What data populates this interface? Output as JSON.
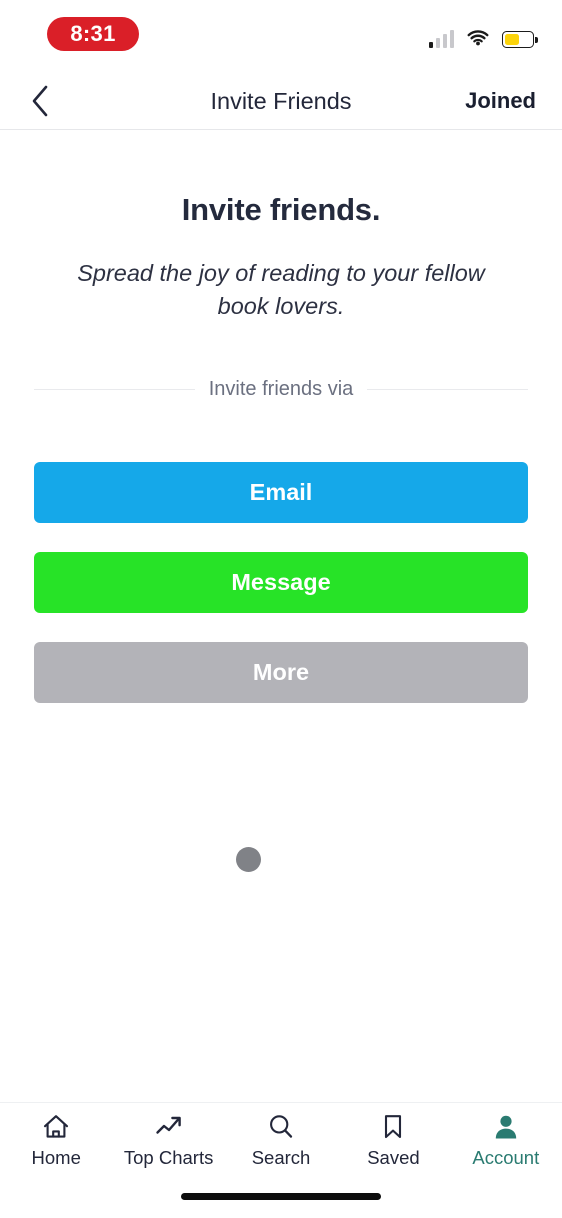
{
  "status_bar": {
    "time": "8:31",
    "recording_pill_color": "#da1f28",
    "signal_icon": "cellular-signal-icon",
    "signal_bars_filled": 1,
    "signal_bars_total": 4,
    "wifi_icon": "wifi-icon",
    "battery_icon": "battery-icon",
    "battery_level_percent": 52,
    "battery_fill_color": "#fcd40b"
  },
  "header": {
    "back_icon": "chevron-left-icon",
    "title": "Invite Friends",
    "action_label": "Joined"
  },
  "main": {
    "headline": "Invite friends.",
    "subheadline": "Spread the joy of reading to your fellow book lovers.",
    "divider_label": "Invite friends via",
    "buttons": [
      {
        "label": "Email",
        "name": "invite-via-email-button",
        "color": "#15a8e9"
      },
      {
        "label": "Message",
        "name": "invite-via-message-button",
        "color": "#27e327"
      },
      {
        "label": "More",
        "name": "invite-via-more-button",
        "color": "#b3b3b8"
      }
    ],
    "loading_indicator": {
      "name": "loading-dot-indicator",
      "color": "#808287"
    }
  },
  "tab_bar": {
    "active_color": "#2a7b71",
    "inactive_color": "#23273a",
    "items": [
      {
        "label": "Home",
        "icon": "home-icon",
        "active": false
      },
      {
        "label": "Top Charts",
        "icon": "trending-up-icon",
        "active": false
      },
      {
        "label": "Search",
        "icon": "search-icon",
        "active": false
      },
      {
        "label": "Saved",
        "icon": "bookmark-icon",
        "active": false
      },
      {
        "label": "Account",
        "icon": "person-icon",
        "active": true
      }
    ]
  },
  "home_indicator": {
    "name": "home-indicator-bar"
  }
}
